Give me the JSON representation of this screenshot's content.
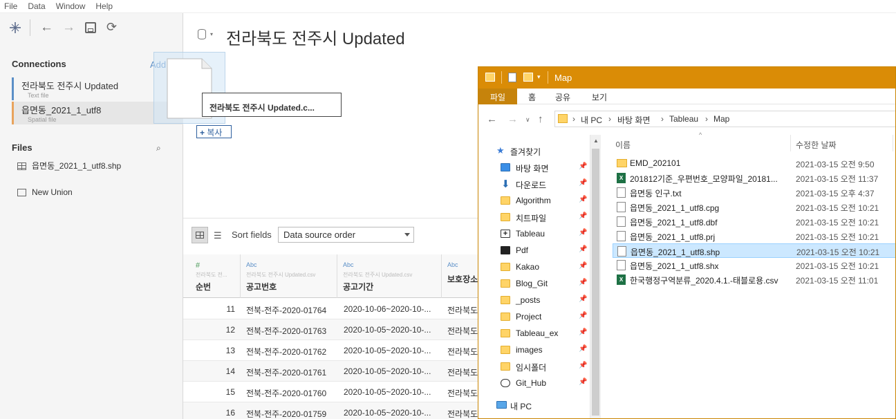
{
  "menu": [
    "File",
    "Data",
    "Window",
    "Help"
  ],
  "connections": {
    "title": "Connections",
    "add_label": "Add",
    "items": [
      {
        "name": "전라북도 전주시 Updated",
        "type": "Text file"
      },
      {
        "name": "읍면동_2021_1_utf8",
        "type": "Spatial file"
      }
    ]
  },
  "files": {
    "title": "Files",
    "items": [
      "읍면동_2021_1_utf8.shp",
      "New Union"
    ]
  },
  "datasource": {
    "title": "전라북도 전주시 Updated"
  },
  "drag": {
    "label": "전라북도 전주시 Updated.c...",
    "copy_label": "복사"
  },
  "sort": {
    "label": "Sort fields",
    "value": "Data source order"
  },
  "grid": {
    "columns": [
      {
        "type": "#",
        "source": "전라북도 전...",
        "name": "순번"
      },
      {
        "type": "Abc",
        "source": "전라북도 전주시 Updated.csv",
        "name": "공고번호"
      },
      {
        "type": "Abc",
        "source": "전라북도 전주시 Updated.csv",
        "name": "공고기간"
      },
      {
        "type": "Abc",
        "source": "",
        "name": "보호장소"
      }
    ],
    "rows": [
      [
        "11",
        "전북-전주-2020-01764",
        "2020-10-06~2020-10-...",
        "전라북도"
      ],
      [
        "12",
        "전북-전주-2020-01763",
        "2020-10-05~2020-10-...",
        "전라북도"
      ],
      [
        "13",
        "전북-전주-2020-01762",
        "2020-10-05~2020-10-...",
        "전라북도"
      ],
      [
        "14",
        "전북-전주-2020-01761",
        "2020-10-05~2020-10-...",
        "전라북도"
      ],
      [
        "15",
        "전북-전주-2020-01760",
        "2020-10-05~2020-10-...",
        "전라북도"
      ],
      [
        "16",
        "전북-전주-2020-01759",
        "2020-10-05~2020-10-...",
        "전라북도"
      ]
    ]
  },
  "explorer": {
    "title": "Map",
    "ribbon_tabs": [
      "파일",
      "홈",
      "공유",
      "보기"
    ],
    "path": [
      "내 PC",
      "바탕 화면",
      "Tableau",
      "Map"
    ],
    "nav_items": [
      {
        "label": "즐겨찾기",
        "icon": "star-icon"
      },
      {
        "label": "바탕 화면",
        "icon": "desktop-icon"
      },
      {
        "label": "다운로드",
        "icon": "download-icon"
      },
      {
        "label": "Algorithm",
        "icon": "folder-icon"
      },
      {
        "label": "치트파일",
        "icon": "folder-icon"
      },
      {
        "label": "Tableau",
        "icon": "tableau-icon"
      },
      {
        "label": "Pdf",
        "icon": "folder-dark-icon"
      },
      {
        "label": "Kakao",
        "icon": "folder-icon"
      },
      {
        "label": "Blog_Git",
        "icon": "folder-icon"
      },
      {
        "label": "_posts",
        "icon": "folder-icon"
      },
      {
        "label": "Project",
        "icon": "folder-icon"
      },
      {
        "label": "Tableau_ex",
        "icon": "folder-icon"
      },
      {
        "label": "images",
        "icon": "folder-icon"
      },
      {
        "label": "임시폴더",
        "icon": "folder-icon"
      },
      {
        "label": "Git_Hub",
        "icon": "github-icon"
      },
      {
        "label": "내 PC",
        "icon": "pc-icon"
      }
    ],
    "columns": {
      "name": "이름",
      "date": "수정한 날짜"
    },
    "files": [
      {
        "name": "EMD_202101",
        "date": "2021-03-15 오전 9:50",
        "icon": "folder-icon"
      },
      {
        "name": "201812기준_우편번호_모양파일_20181...",
        "date": "2021-03-15 오전 11:37",
        "icon": "excel-icon"
      },
      {
        "name": "읍면동 인구.txt",
        "date": "2021-03-15 오후 4:37",
        "icon": "file-icon"
      },
      {
        "name": "읍면동_2021_1_utf8.cpg",
        "date": "2021-03-15 오전 10:21",
        "icon": "file-icon"
      },
      {
        "name": "읍면동_2021_1_utf8.dbf",
        "date": "2021-03-15 오전 10:21",
        "icon": "file-icon"
      },
      {
        "name": "읍면동_2021_1_utf8.prj",
        "date": "2021-03-15 오전 10:21",
        "icon": "file-icon"
      },
      {
        "name": "읍면동_2021_1_utf8.shp",
        "date": "2021-03-15 오전 10:21",
        "icon": "file-icon",
        "selected": true
      },
      {
        "name": "읍면동_2021_1_utf8.shx",
        "date": "2021-03-15 오전 10:21",
        "icon": "file-icon"
      },
      {
        "name": "한국행정구역분류_2020.4.1.-태블로용.csv",
        "date": "2021-03-15 오전 11:01",
        "icon": "excel-icon"
      }
    ]
  },
  "colors": {
    "accent": "#5b8fc7",
    "explorer_title": "#da8c06",
    "selection": "#cce8ff"
  }
}
